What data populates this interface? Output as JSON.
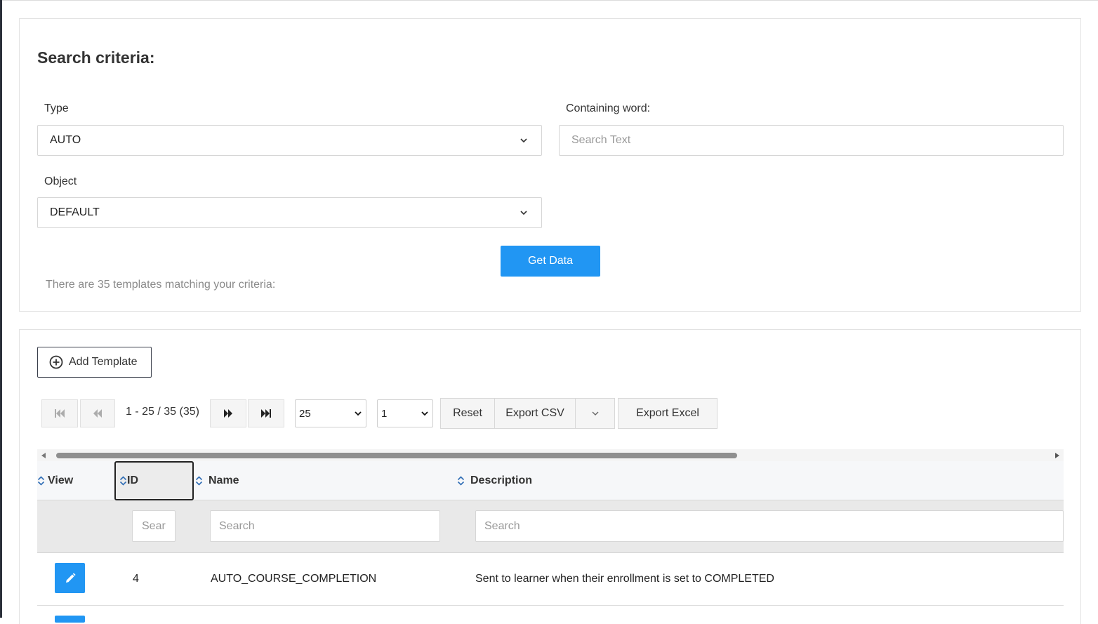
{
  "search": {
    "title": "Search criteria:",
    "type_label": "Type",
    "type_value": "AUTO",
    "containing_label": "Containing word:",
    "containing_placeholder": "Search Text",
    "object_label": "Object",
    "object_value": "DEFAULT",
    "get_data_label": "Get Data",
    "result_hint": "There are 35 templates matching your criteria:"
  },
  "results": {
    "add_template_label": "Add Template",
    "pagination": {
      "info": "1 - 25 / 35 (35)",
      "page_size": "25",
      "page_number": "1"
    },
    "toolbar": {
      "reset_label": "Reset",
      "export_csv_label": "Export CSV",
      "export_excel_label": "Export Excel"
    },
    "columns": [
      "View",
      "ID",
      "Name",
      "Description"
    ],
    "filter_placeholder": "Search",
    "filter_placeholder_truncated": "Sear",
    "rows": [
      {
        "id": "4",
        "name": "AUTO_COURSE_COMPLETION",
        "description": "Sent to learner when their enrollment is set to COMPLETED"
      }
    ]
  },
  "icons": {
    "chevron": "chevron-down-icon",
    "add": "plus-circle-icon",
    "edit": "pencil-icon",
    "first": "first-page-icon",
    "prev": "previous-page-icon",
    "next": "next-page-icon",
    "last": "last-page-icon",
    "sort": "sort-icon"
  },
  "colors": {
    "primary": "#2196f3",
    "sort_icon": "#2f6db5"
  }
}
